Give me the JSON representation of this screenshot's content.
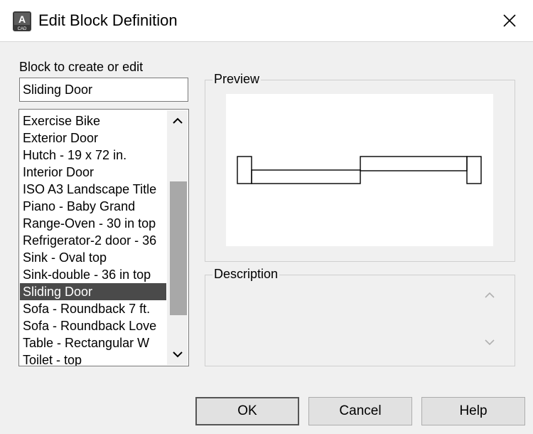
{
  "window": {
    "title": "Edit Block Definition",
    "icon_text": "A",
    "icon_subtext": "CAD"
  },
  "block_section": {
    "label": "Block to create or edit",
    "value": "Sliding Door",
    "items": [
      "Exercise Bike",
      "Exterior Door",
      "Hutch - 19 x 72 in.",
      "Interior Door",
      "ISO A3 Landscape Title",
      "Piano - Baby Grand",
      "Range-Oven - 30 in top",
      "Refrigerator-2 door - 36",
      "Sink - Oval top",
      "Sink-double - 36 in top",
      "Sliding Door",
      "Sofa - Roundback 7 ft.",
      "Sofa - Roundback Love",
      "Table - Rectangular W",
      "Toilet - top"
    ],
    "selected_index": 10
  },
  "preview": {
    "label": "Preview"
  },
  "description": {
    "label": "Description",
    "value": ""
  },
  "buttons": {
    "ok": "OK",
    "cancel": "Cancel",
    "help": "Help"
  },
  "icons": {
    "app": "autocad-app-icon",
    "close": "close-icon",
    "scroll_up": "chevron-up-icon",
    "scroll_down": "chevron-down-icon"
  }
}
